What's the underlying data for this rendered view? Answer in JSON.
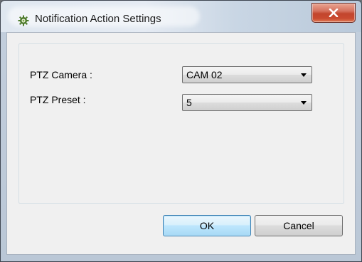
{
  "window": {
    "title": "Notification Action Settings",
    "icon": "gear-icon",
    "close_icon": "close-icon"
  },
  "form": {
    "ptz_camera": {
      "label": "PTZ Camera :",
      "value": "CAM 02"
    },
    "ptz_preset": {
      "label": "PTZ Preset :",
      "value": "5"
    }
  },
  "buttons": {
    "ok_label": "OK",
    "cancel_label": "Cancel"
  },
  "colors": {
    "close_button": "#c94a30",
    "default_button_border": "#3c7fb1",
    "dialog_background": "#f0f0f0"
  }
}
